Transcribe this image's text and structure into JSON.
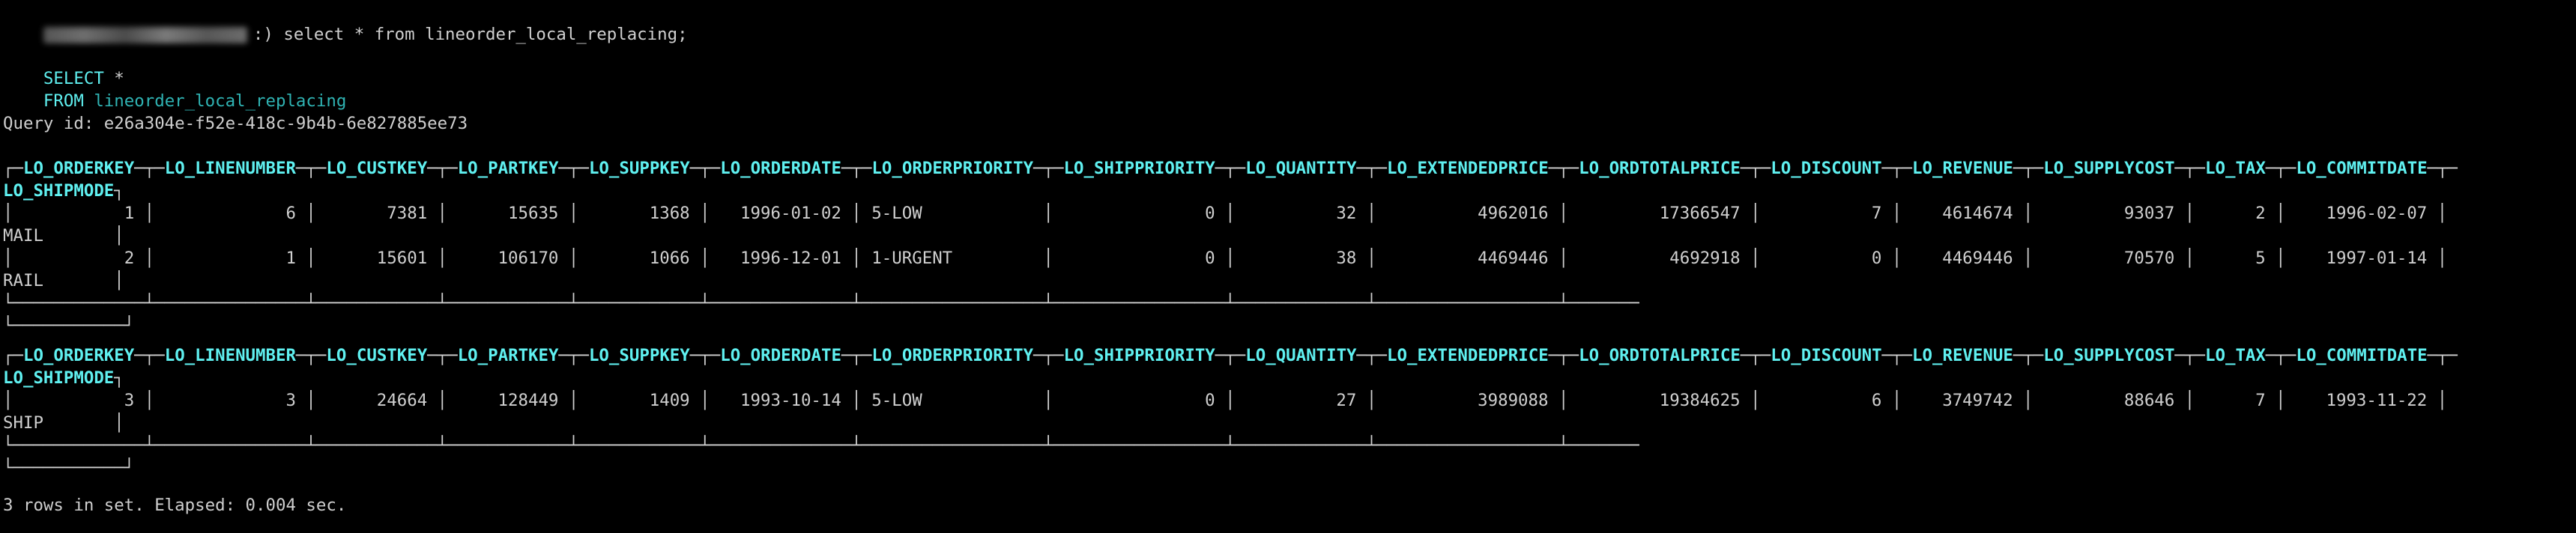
{
  "prompt": {
    "redacted": true,
    "suffix": ":) ",
    "command": "select * from lineorder_local_replacing;"
  },
  "query": {
    "select_kw": "SELECT",
    "select_rest": " *",
    "from_kw": "FROM",
    "table": "lineorder_local_replacing"
  },
  "query_id_line": "Query id: e26a304e-f52e-418c-9b4b-6e827885ee73",
  "columns": [
    "LO_ORDERKEY",
    "LO_LINENUMBER",
    "LO_CUSTKEY",
    "LO_PARTKEY",
    "LO_SUPPKEY",
    "LO_ORDERDATE",
    "LO_ORDERPRIORITY",
    "LO_SHIPPRIORITY",
    "LO_QUANTITY",
    "LO_EXTENDEDPRICE",
    "LO_ORDTOTALPRICE",
    "LO_DISCOUNT",
    "LO_REVENUE",
    "LO_SUPPLYCOST",
    "LO_TAX",
    "LO_COMMITDATE",
    "LO_SHIPMODE"
  ],
  "blocks": [
    {
      "rows": [
        [
          "1",
          "6",
          "7381",
          "15635",
          "1368",
          "1996-01-02",
          "5-LOW",
          "0",
          "32",
          "4962016",
          "17366547",
          "7",
          "4614674",
          "93037",
          "2",
          "1996-02-07",
          "MAIL"
        ],
        [
          "2",
          "1",
          "15601",
          "106170",
          "1066",
          "1996-12-01",
          "1-URGENT",
          "0",
          "38",
          "4469446",
          "4692918",
          "0",
          "4469446",
          "70570",
          "5",
          "1997-01-14",
          "RAIL"
        ]
      ]
    },
    {
      "rows": [
        [
          "3",
          "3",
          "24664",
          "128449",
          "1409",
          "1993-10-14",
          "5-LOW",
          "0",
          "27",
          "3989088",
          "19384625",
          "6",
          "3749742",
          "88646",
          "7",
          "1993-11-22",
          "SHIP"
        ]
      ]
    }
  ],
  "footer": "3 rows in set. Elapsed: 0.004 sec.",
  "colors": {
    "background": "#000000",
    "text": "#cfcfcf",
    "header": "#5ff0f0",
    "table_name": "#2fb3b3"
  }
}
